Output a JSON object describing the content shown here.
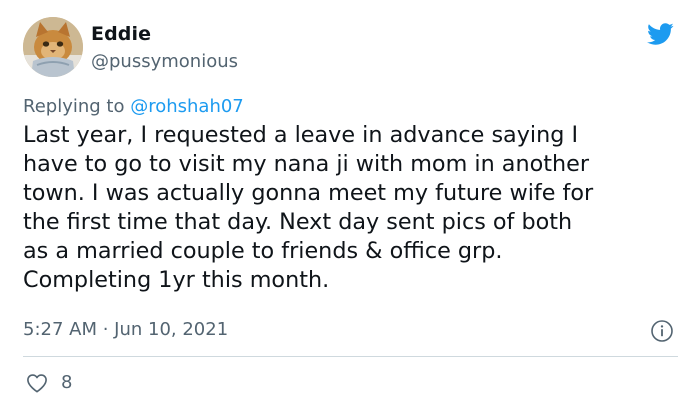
{
  "author": {
    "display_name": "Eddie",
    "handle": "@pussymonious",
    "avatar_icon": "cat-avatar"
  },
  "brand": {
    "icon": "twitter-bird-icon",
    "color": "#1d9bf0"
  },
  "reply": {
    "prefix": "Replying to ",
    "mention": "@rohshah07"
  },
  "tweet": {
    "text": "Last year, I requested a leave in advance saying I\nhave to go to visit my nana ji with mom in another\ntown. I was actually gonna meet my future wife for\nthe first time that day. Next day sent pics of both\nas a married couple to friends & office grp.\nCompleting 1yr this month.",
    "timestamp": "5:27 AM · Jun 10, 2021",
    "info_icon": "info-icon"
  },
  "engagement": {
    "like_icon": "heart-icon",
    "like_count": "8"
  },
  "colors": {
    "text": "#0f1419",
    "secondary": "#536471",
    "accent": "#1d9bf0",
    "divider": "#cfd9de"
  }
}
